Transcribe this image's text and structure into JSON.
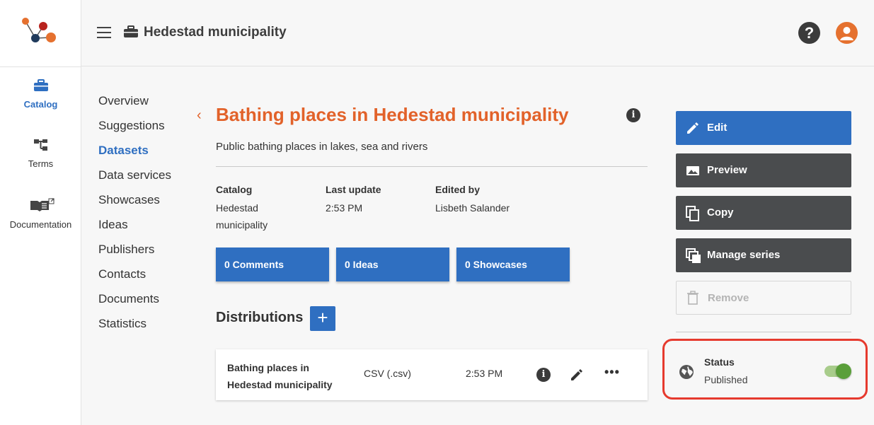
{
  "rail": {
    "items": [
      {
        "label": "Catalog",
        "icon": "briefcase-icon",
        "active": true
      },
      {
        "label": "Terms",
        "icon": "hierarchy-icon",
        "active": false
      },
      {
        "label": "Documentation",
        "icon": "book-external-icon",
        "active": false
      }
    ]
  },
  "header": {
    "title": "Hedestad municipality",
    "help_label": "?"
  },
  "subnav": {
    "items": [
      "Overview",
      "Suggestions",
      "Datasets",
      "Data services",
      "Showcases",
      "Ideas",
      "Publishers",
      "Contacts",
      "Documents",
      "Statistics"
    ],
    "active": "Datasets"
  },
  "dataset": {
    "back_label": "‹",
    "title": "Bathing places in Hedestad municipality",
    "description": "Public bathing places in lakes, sea and rivers",
    "info_label": "i",
    "meta": [
      {
        "heading": "Catalog",
        "value_line1": "Hedestad",
        "value_line2": "municipality"
      },
      {
        "heading": "Last update",
        "value_line1": "2:53 PM",
        "value_line2": ""
      },
      {
        "heading": "Edited by",
        "value_line1": "Lisbeth Salander",
        "value_line2": ""
      }
    ],
    "counters": [
      {
        "label": "0  Comments"
      },
      {
        "label": "0  Ideas"
      },
      {
        "label": "0  Showcases"
      }
    ]
  },
  "distributions": {
    "heading": "Distributions",
    "add_label": "+",
    "items": [
      {
        "name_line1": "Bathing places in",
        "name_line2": "Hedestad municipality",
        "format": "CSV (.csv)",
        "time": "2:53 PM",
        "info_label": "i",
        "more_label": "•••"
      }
    ]
  },
  "actions": {
    "edit": "Edit",
    "preview": "Preview",
    "copy": "Copy",
    "manage_series": "Manage series",
    "remove": "Remove"
  },
  "status": {
    "label": "Status",
    "value": "Published",
    "enabled": true
  },
  "colors": {
    "accent_orange": "#e2622a",
    "primary_blue": "#2f6fc1",
    "dark_button": "#4a4c4e",
    "highlight_red": "#e63a2e",
    "toggle_green": "#5a9f3a"
  }
}
